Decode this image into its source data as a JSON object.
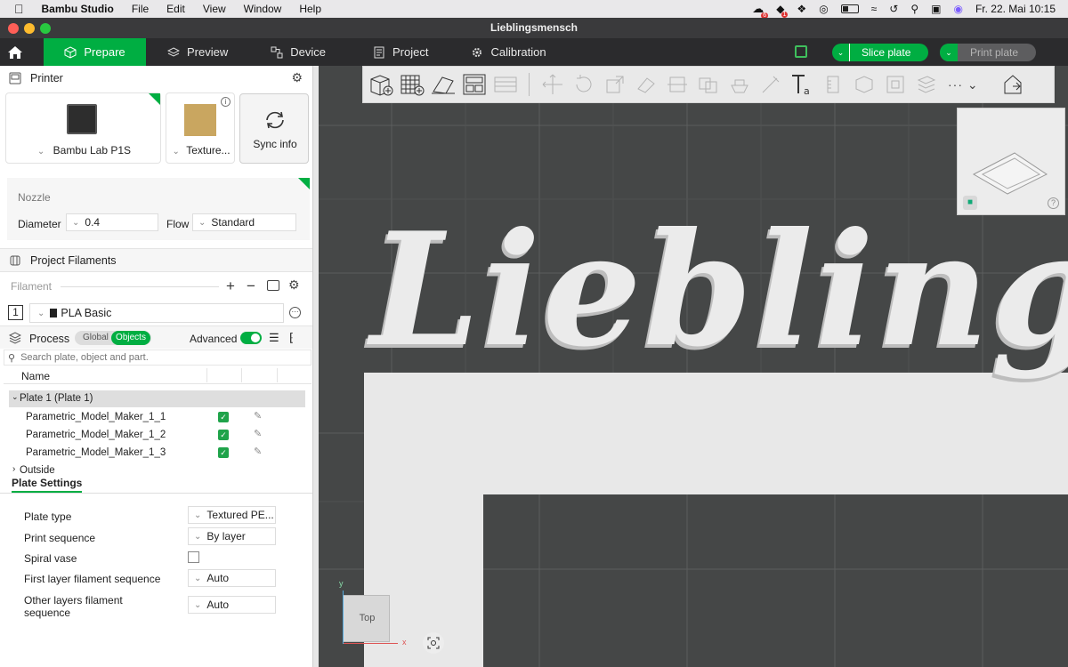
{
  "menubar": {
    "app": "Bambu Studio",
    "items": [
      "File",
      "Edit",
      "View",
      "Window",
      "Help"
    ],
    "datetime": "Fr. 22. Mai  10:15",
    "badges": [
      "6",
      "1"
    ]
  },
  "window": {
    "title": "Lieblingsmensch"
  },
  "tabs": {
    "prepare": "Prepare",
    "preview": "Preview",
    "device": "Device",
    "project": "Project",
    "calibration": "Calibration"
  },
  "actions": {
    "slice": "Slice plate",
    "print": "Print plate"
  },
  "printer": {
    "header": "Printer",
    "model": "Bambu Lab P1S",
    "plate": "Texture...",
    "sync": "Sync info"
  },
  "nozzle": {
    "label": "Nozzle",
    "diameter_label": "Diameter",
    "diameter": "0.4",
    "flow_label": "Flow",
    "flow": "Standard"
  },
  "filaments": {
    "header": "Project Filaments",
    "label": "Filament",
    "slot": "1",
    "name": "PLA Basic"
  },
  "process": {
    "header": "Process",
    "global": "Global",
    "objects": "Objects",
    "advanced": "Advanced",
    "search_placeholder": "Search plate, object and part."
  },
  "objects": {
    "name_col": "Name",
    "plate": "Plate 1 (Plate 1)",
    "items": [
      "Parametric_Model_Maker_1_1",
      "Parametric_Model_Maker_1_2",
      "Parametric_Model_Maker_1_3"
    ],
    "outside": "Outside"
  },
  "plate_settings": {
    "header": "Plate Settings",
    "plate_type_label": "Plate type",
    "plate_type": "Textured PE...",
    "print_seq_label": "Print sequence",
    "print_seq": "By layer",
    "spiral_label": "Spiral vase",
    "first_layer_label": "First layer filament sequence",
    "first_layer": "Auto",
    "other_layers_label_1": "Other layers filament",
    "other_layers_label_2": "sequence",
    "other_layers": "Auto"
  },
  "viewport": {
    "model_text": "Lieblingsm",
    "view_cube": "Top",
    "axis_x": "x",
    "axis_y": "y",
    "accent": "#00ae42",
    "bg": "#454747"
  }
}
